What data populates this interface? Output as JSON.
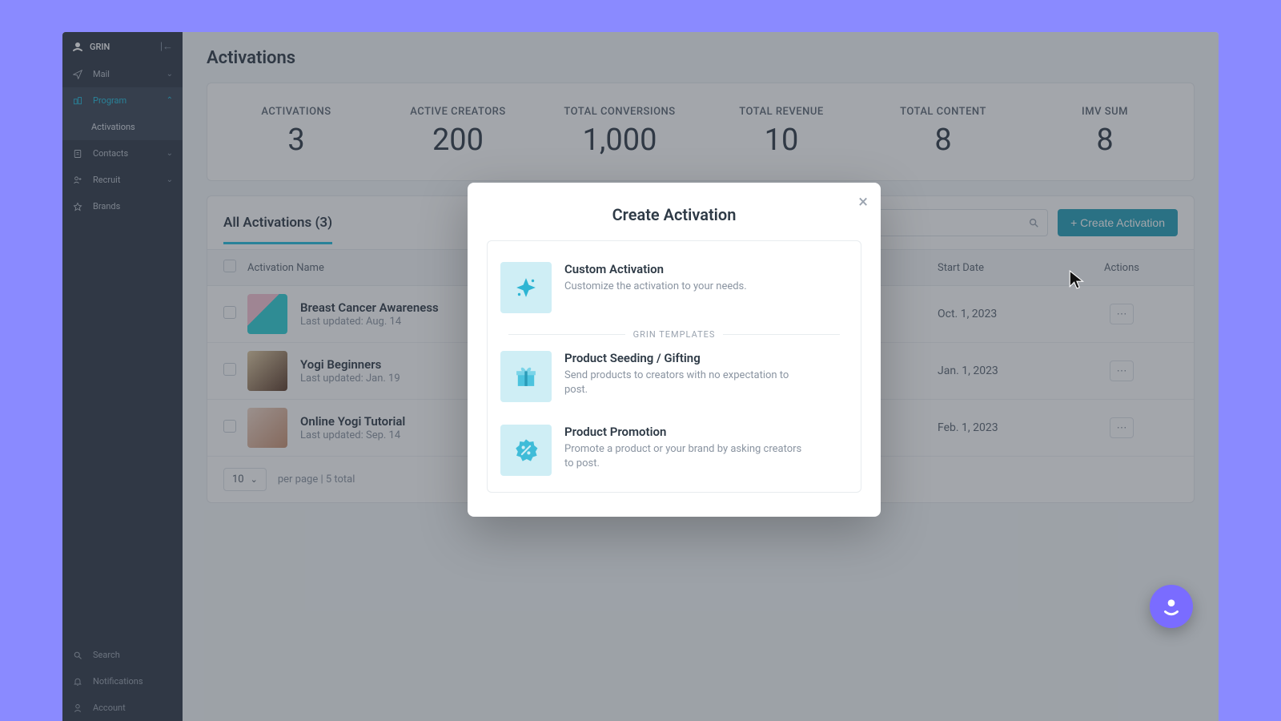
{
  "brand": {
    "name": "GRIN"
  },
  "sidebar": {
    "items": [
      {
        "label": "Mail"
      },
      {
        "label": "Program"
      },
      {
        "label": "Contacts"
      },
      {
        "label": "Recruit"
      },
      {
        "label": "Brands"
      }
    ],
    "sub_active": "Activations",
    "bottom": [
      {
        "label": "Search"
      },
      {
        "label": "Notifications"
      },
      {
        "label": "Account"
      }
    ]
  },
  "page": {
    "title": "Activations",
    "tab_label": "All Activations (3)",
    "create_label": "+ Create Activation",
    "per_page_value": "10",
    "footer_text": "per page | 5 total"
  },
  "stats": [
    {
      "label": "ACTIVATIONS",
      "value": "3"
    },
    {
      "label": "ACTIVE CREATORS",
      "value": "200"
    },
    {
      "label": "TOTAL CONVERSIONS",
      "value": "1,000"
    },
    {
      "label": "TOTAL REVENUE",
      "value": "10"
    },
    {
      "label": "TOTAL CONTENT",
      "value": "8"
    },
    {
      "label": "IMV SUM",
      "value": "8"
    }
  ],
  "table": {
    "headers": {
      "name": "Activation Name",
      "start": "Start Date",
      "actions": "Actions"
    },
    "rows": [
      {
        "name": "Breast Cancer Awareness",
        "meta": "Last updated: Aug. 14",
        "start": "Oct. 1, 2023",
        "thumb": "linear-gradient(135deg,#f8c3d4 40%,#2dd0d6 40%)"
      },
      {
        "name": "Yogi Beginners",
        "meta": "Last updated: Jan. 19",
        "start": "Jan. 1, 2023",
        "thumb": "linear-gradient(135deg,#e0c9a0,#5b3a28)"
      },
      {
        "name": "Online Yogi Tutorial",
        "meta": "Last updated: Sep. 14",
        "start": "Feb. 1, 2023",
        "thumb": "linear-gradient(135deg,#f0d7c8,#c89070)"
      }
    ]
  },
  "modal": {
    "title": "Create Activation",
    "templates_label": "GRIN TEMPLATES",
    "options": [
      {
        "title": "Custom Activation",
        "desc": "Customize the activation to your needs."
      },
      {
        "title": "Product Seeding / Gifting",
        "desc": "Send products to creators with no expectation to post."
      },
      {
        "title": "Product Promotion",
        "desc": "Promote a product or your brand by asking creators to post."
      }
    ]
  }
}
